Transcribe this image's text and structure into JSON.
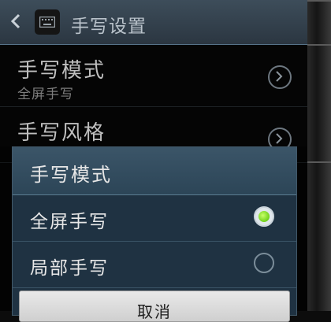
{
  "action_bar": {
    "title": "手写设置"
  },
  "preferences": [
    {
      "title": "手写模式",
      "summary": "全屏手写"
    },
    {
      "title": "手写风格",
      "summary": ""
    }
  ],
  "dialog": {
    "title": "手写模式",
    "options": [
      {
        "label": "全屏手写",
        "selected": true
      },
      {
        "label": "局部手写",
        "selected": false
      }
    ],
    "cancel_label": "取消"
  },
  "colors": {
    "radio_selected": "#6fd11a",
    "dialog_bg": "#1f3242",
    "action_bar": "#2b3641"
  }
}
